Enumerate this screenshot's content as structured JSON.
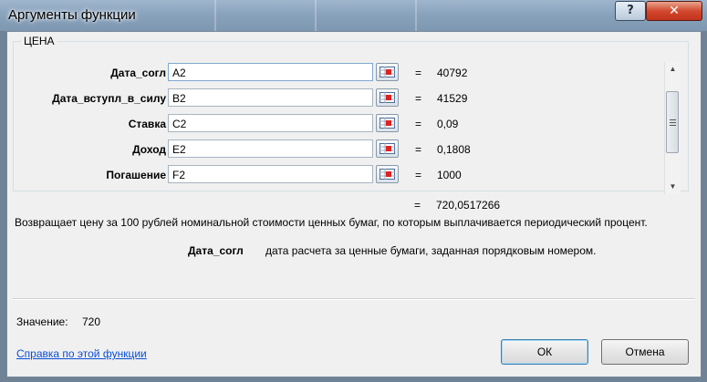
{
  "window": {
    "title": "Аргументы функции",
    "help": "?",
    "close": "✕"
  },
  "function_name": "ЦЕНА",
  "arguments": [
    {
      "label": "Дата_согл",
      "value": "A2",
      "result": "40792"
    },
    {
      "label": "Дата_вступл_в_силу",
      "value": "B2",
      "result": "41529"
    },
    {
      "label": "Ставка",
      "value": "C2",
      "result": "0,09"
    },
    {
      "label": "Доход",
      "value": "E2",
      "result": "0,1808"
    },
    {
      "label": "Погашение",
      "value": "F2",
      "result": "1000"
    }
  ],
  "equals": "=",
  "formula_result": "720,0517266",
  "description": "Возвращает цену за 100 рублей номинальной стоимости ценных бумаг, по которым выплачивается периодический процент.",
  "arg_help": {
    "name": "Дата_согл",
    "text": "дата расчета за ценные бумаги, заданная порядковым номером."
  },
  "value": {
    "label": "Значение:",
    "number": "720"
  },
  "help_link": "Справка по этой функции",
  "buttons": {
    "ok": "ОК",
    "cancel": "Отмена"
  },
  "icons": {
    "ref": "range-select-icon",
    "scroll_up": "scroll-up-icon",
    "scroll_down": "scroll-down-icon"
  }
}
